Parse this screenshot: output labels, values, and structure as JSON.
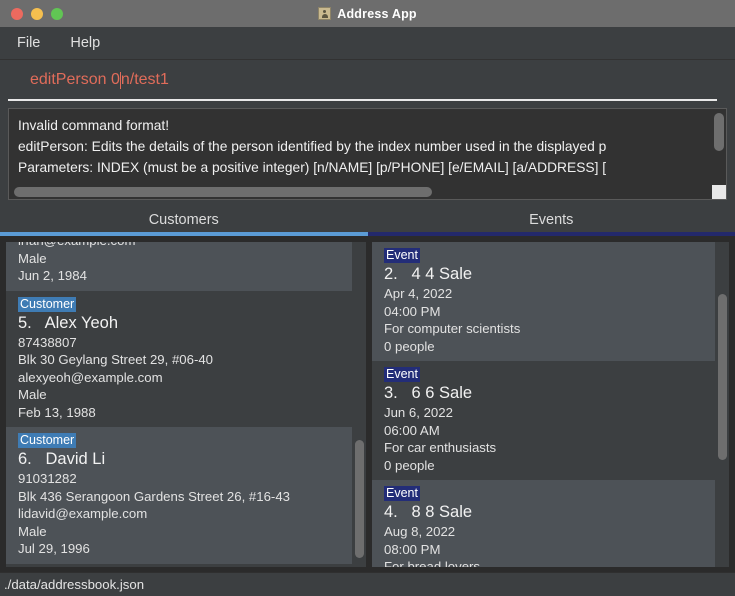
{
  "window": {
    "title": "Address App",
    "icon": "person-card-icon",
    "traffic_lights": [
      "close",
      "minimize",
      "zoom"
    ]
  },
  "menubar": {
    "items": [
      {
        "label": "File"
      },
      {
        "label": "Help"
      }
    ]
  },
  "command_box": {
    "value_before_caret": "editPerson 0",
    "value_after_caret": "n/test1",
    "full_value": "editPerson 0n/test1",
    "text_color": "#e06c5a"
  },
  "result_display": {
    "lines": [
      "Invalid command format!",
      "editPerson: Edits the details of the person identified by the index number used in the displayed p",
      "Parameters: INDEX (must be a positive integer) [n/NAME] [p/PHONE] [e/EMAIL] [a/ADDRESS] ["
    ],
    "has_vertical_scrollbar": true,
    "has_horizontal_scrollbar": true
  },
  "tabs": [
    {
      "label": "Customers",
      "active": true,
      "underline_color": "#5b9bd5"
    },
    {
      "label": "Events",
      "active": false,
      "underline_color": "#23296b"
    }
  ],
  "customers_panel": {
    "cards": [
      {
        "partial": true,
        "badge": "",
        "title": "",
        "lines": [
          "irfan@example.com",
          "Male",
          "Jun 2, 1984"
        ],
        "alt": true
      },
      {
        "partial": false,
        "badge": "Customer",
        "title": "5.   Alex Yeoh",
        "lines": [
          "87438807",
          "Blk 30 Geylang Street 29, #06-40",
          "alexyeoh@example.com",
          "Male",
          "Feb 13, 1988"
        ],
        "alt": false
      },
      {
        "partial": false,
        "badge": "Customer",
        "title": "6.   David Li",
        "lines": [
          "91031282",
          "Blk 436 Serangoon Gardens Street 26, #16-43",
          "lidavid@example.com",
          "Male",
          "Jul 29, 1996"
        ],
        "alt": true
      }
    ]
  },
  "events_panel": {
    "cards": [
      {
        "badge": "Event",
        "title": "2.   4 4 Sale",
        "lines": [
          "Apr 4, 2022",
          "04:00 PM",
          "For computer scientists",
          "0 people"
        ],
        "alt": true
      },
      {
        "badge": "Event",
        "title": "3.   6 6 Sale",
        "lines": [
          "Jun 6, 2022",
          "06:00 AM",
          "For car enthusiasts",
          "0 people"
        ],
        "alt": false
      },
      {
        "badge": "Event",
        "title": "4.   8 8 Sale",
        "lines": [
          "Aug 8, 2022",
          "08:00 PM",
          "For bread lovers"
        ],
        "alt": true
      }
    ]
  },
  "statusbar": {
    "path": "./data/addressbook.json"
  }
}
